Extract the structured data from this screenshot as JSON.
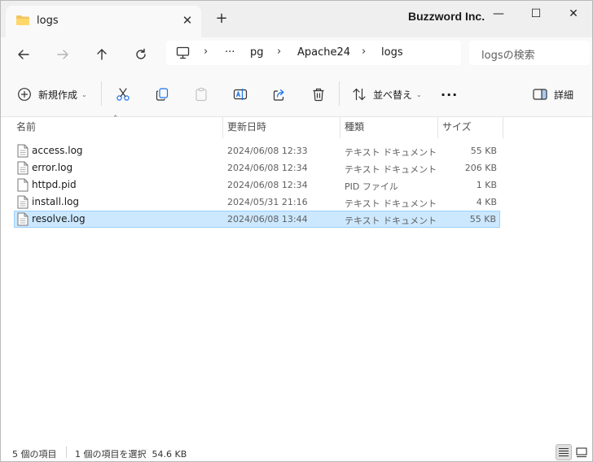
{
  "window": {
    "tab_title": "logs",
    "tab_close": "✕",
    "new_tab": "+",
    "brand": "Buzzword Inc.",
    "minimize": "—",
    "maximize": "☐",
    "close": "✕"
  },
  "address": {
    "more": "···",
    "crumbs": [
      "pg",
      "Apache24",
      "logs"
    ],
    "search_placeholder": "logsの検索"
  },
  "toolbar": {
    "new_label": "新規作成",
    "sort_label": "並べ替え",
    "more_label": "···",
    "details_label": "詳細"
  },
  "columns": {
    "name": "名前",
    "date": "更新日時",
    "type": "種類",
    "size": "サイズ"
  },
  "files": [
    {
      "name": "access.log",
      "date": "2024/06/08 12:33",
      "type": "テキスト ドキュメント",
      "size": "55 KB",
      "selected": false
    },
    {
      "name": "error.log",
      "date": "2024/06/08 12:34",
      "type": "テキスト ドキュメント",
      "size": "206 KB",
      "selected": false
    },
    {
      "name": "httpd.pid",
      "date": "2024/06/08 12:34",
      "type": "PID ファイル",
      "size": "1 KB",
      "selected": false
    },
    {
      "name": "install.log",
      "date": "2024/05/31 21:16",
      "type": "テキスト ドキュメント",
      "size": "4 KB",
      "selected": false
    },
    {
      "name": "resolve.log",
      "date": "2024/06/08 13:44",
      "type": "テキスト ドキュメント",
      "size": "55 KB",
      "selected": true
    }
  ],
  "status": {
    "item_count": "5 個の項目",
    "selection": "1 個の項目を選択  54.6 KB"
  },
  "colors": {
    "accent": "#1a73e8",
    "selection": "#cce8ff",
    "folder": "#f2c55c"
  }
}
